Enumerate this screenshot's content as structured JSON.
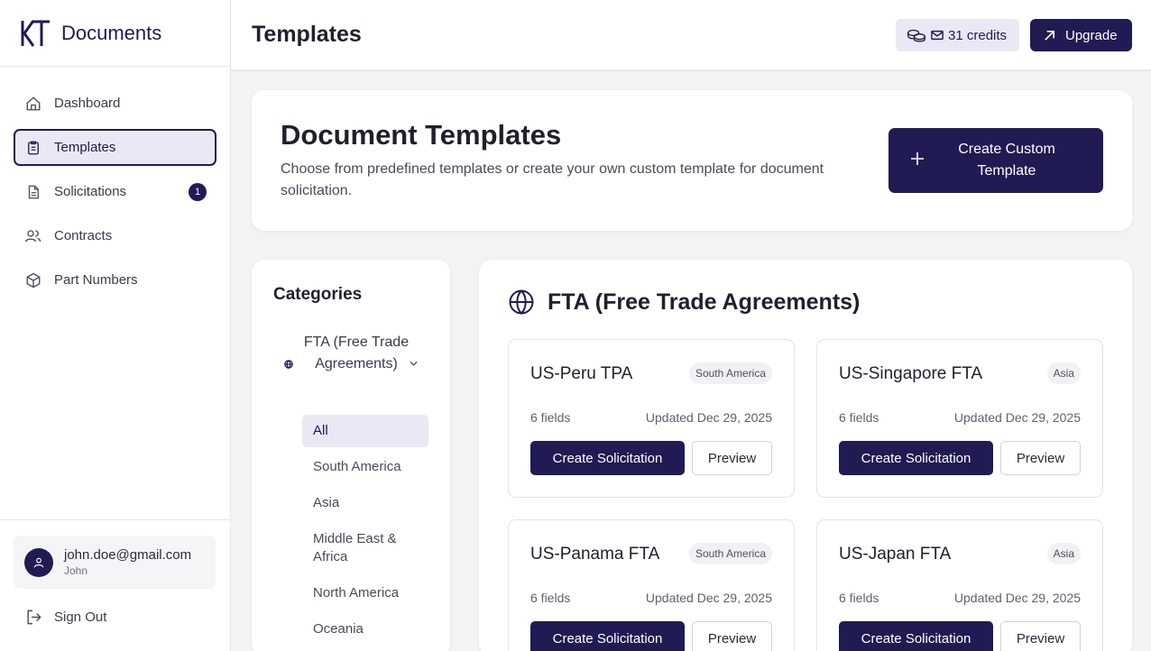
{
  "brand": {
    "name": "Documents"
  },
  "nav": [
    {
      "label": "Dashboard",
      "icon": "home-icon"
    },
    {
      "label": "Templates",
      "icon": "document-icon",
      "active": true
    },
    {
      "label": "Solicitations",
      "icon": "file-icon",
      "badge": "1"
    },
    {
      "label": "Contracts",
      "icon": "users-icon"
    },
    {
      "label": "Part Numbers",
      "icon": "package-icon"
    }
  ],
  "user": {
    "email": "john.doe@gmail.com",
    "name": "John"
  },
  "signout": {
    "label": "Sign Out"
  },
  "header": {
    "title": "Templates",
    "credits": "31 credits",
    "upgrade": "Upgrade"
  },
  "hero": {
    "title": "Document Templates",
    "description": "Choose from predefined templates or create your own custom template for document solicitation.",
    "create_label": "Create Custom Template"
  },
  "categories": {
    "title": "Categories",
    "group": "FTA (Free Trade Agreements)",
    "items": [
      "All",
      "South America",
      "Asia",
      "Middle East & Africa",
      "North America",
      "Oceania"
    ]
  },
  "panel": {
    "title": "FTA (Free Trade Agreements)",
    "create_label": "Create Solicitation",
    "preview_label": "Preview",
    "templates": [
      {
        "name": "US-Peru TPA",
        "region": "South America",
        "fields": "6 fields",
        "updated": "Updated Dec 29, 2025"
      },
      {
        "name": "US-Singapore FTA",
        "region": "Asia",
        "fields": "6 fields",
        "updated": "Updated Dec 29, 2025"
      },
      {
        "name": "US-Panama FTA",
        "region": "South America",
        "fields": "6 fields",
        "updated": "Updated Dec 29, 2025"
      },
      {
        "name": "US-Japan FTA",
        "region": "Asia",
        "fields": "6 fields",
        "updated": "Updated Dec 29, 2025"
      }
    ]
  },
  "colors": {
    "accent": "#201b52",
    "accent_light": "#e9e8f4",
    "background": "#f3f3f6"
  }
}
